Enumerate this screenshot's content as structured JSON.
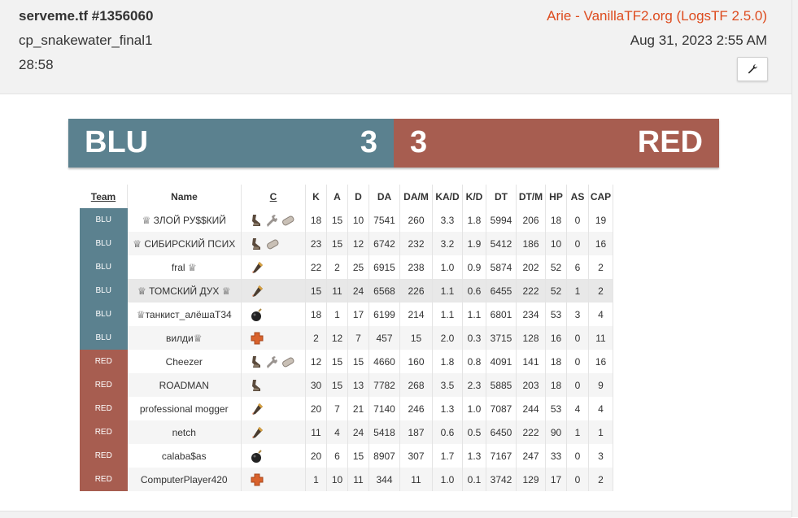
{
  "header": {
    "title": "serveme.tf #1356060",
    "map": "cp_snakewater_final1",
    "duration": "28:58",
    "uploader": "Arie - VanillaTF2.org (LogsTF 2.5.0)",
    "date": "Aug 31, 2023 2:55 AM",
    "tools_icon": "wrench-icon"
  },
  "score": {
    "blu": {
      "name": "BLU",
      "points": "3",
      "color": "#5b818f"
    },
    "red": {
      "name": "RED",
      "points": "3",
      "color": "#a75d50"
    }
  },
  "table": {
    "headers": {
      "team": "Team",
      "name": "Name",
      "class": "C",
      "k": "K",
      "a": "A",
      "d": "D",
      "da": "DA",
      "dam": "DA/M",
      "kad": "KA/D",
      "kd": "K/D",
      "dt": "DT",
      "dtm": "DT/M",
      "hp": "HP",
      "as": "AS",
      "cap": "CAP"
    },
    "rows": [
      {
        "team": "BLU",
        "name": "♕ ЗЛОЙ РУ$$КИЙ",
        "classes": [
          "scout-icon",
          "engineer-icon",
          "medic-pill-icon"
        ],
        "k": "18",
        "a": "15",
        "d": "10",
        "da": "7541",
        "dam": "260",
        "kad": "3.3",
        "kd": "1.8",
        "dt": "5994",
        "dtm": "206",
        "hp": "18",
        "as": "0",
        "cap": "19"
      },
      {
        "team": "BLU",
        "name": "♕ СИБИРСКИЙ ПСИХ",
        "classes": [
          "scout-icon",
          "medic-pill-icon"
        ],
        "k": "23",
        "a": "15",
        "d": "12",
        "da": "6742",
        "dam": "232",
        "kad": "3.2",
        "kd": "1.9",
        "dt": "5412",
        "dtm": "186",
        "hp": "10",
        "as": "0",
        "cap": "16"
      },
      {
        "team": "BLU",
        "name": "fral ♕",
        "classes": [
          "soldier-icon"
        ],
        "k": "22",
        "a": "2",
        "d": "25",
        "da": "6915",
        "dam": "238",
        "kad": "1.0",
        "kd": "0.9",
        "dt": "5874",
        "dtm": "202",
        "hp": "52",
        "as": "6",
        "cap": "2"
      },
      {
        "team": "BLU",
        "name": "♕ ТОМСКИЙ ДУХ ♕",
        "classes": [
          "soldier-icon"
        ],
        "k": "15",
        "a": "11",
        "d": "24",
        "da": "6568",
        "dam": "226",
        "kad": "1.1",
        "kd": "0.6",
        "dt": "6455",
        "dtm": "222",
        "hp": "52",
        "as": "1",
        "cap": "2"
      },
      {
        "team": "BLU",
        "name": "♕танкист_алёшаТ34",
        "classes": [
          "demoman-icon"
        ],
        "k": "18",
        "a": "1",
        "d": "17",
        "da": "6199",
        "dam": "214",
        "kad": "1.1",
        "kd": "1.1",
        "dt": "6801",
        "dtm": "234",
        "hp": "53",
        "as": "3",
        "cap": "4"
      },
      {
        "team": "BLU",
        "name": "вилди♕",
        "classes": [
          "medic-icon"
        ],
        "k": "2",
        "a": "12",
        "d": "7",
        "da": "457",
        "dam": "15",
        "kad": "2.0",
        "kd": "0.3",
        "dt": "3715",
        "dtm": "128",
        "hp": "16",
        "as": "0",
        "cap": "11"
      },
      {
        "team": "RED",
        "name": "Cheezer",
        "classes": [
          "scout-icon",
          "engineer-icon",
          "medic-pill-icon"
        ],
        "k": "12",
        "a": "15",
        "d": "15",
        "da": "4660",
        "dam": "160",
        "kad": "1.8",
        "kd": "0.8",
        "dt": "4091",
        "dtm": "141",
        "hp": "18",
        "as": "0",
        "cap": "16"
      },
      {
        "team": "RED",
        "name": "ROADMAN",
        "classes": [
          "scout-icon"
        ],
        "k": "30",
        "a": "15",
        "d": "13",
        "da": "7782",
        "dam": "268",
        "kad": "3.5",
        "kd": "2.3",
        "dt": "5885",
        "dtm": "203",
        "hp": "18",
        "as": "0",
        "cap": "9"
      },
      {
        "team": "RED",
        "name": "professional mogger",
        "classes": [
          "soldier-icon"
        ],
        "k": "20",
        "a": "7",
        "d": "21",
        "da": "7140",
        "dam": "246",
        "kad": "1.3",
        "kd": "1.0",
        "dt": "7087",
        "dtm": "244",
        "hp": "53",
        "as": "4",
        "cap": "4"
      },
      {
        "team": "RED",
        "name": "netch",
        "classes": [
          "soldier-icon"
        ],
        "k": "11",
        "a": "4",
        "d": "24",
        "da": "5418",
        "dam": "187",
        "kad": "0.6",
        "kd": "0.5",
        "dt": "6450",
        "dtm": "222",
        "hp": "90",
        "as": "1",
        "cap": "1"
      },
      {
        "team": "RED",
        "name": "calaba$as",
        "classes": [
          "demoman-icon"
        ],
        "k": "20",
        "a": "6",
        "d": "15",
        "da": "8907",
        "dam": "307",
        "kad": "1.7",
        "kd": "1.3",
        "dt": "7167",
        "dtm": "247",
        "hp": "33",
        "as": "0",
        "cap": "3"
      },
      {
        "team": "RED",
        "name": "ComputerPlayer420",
        "classes": [
          "medic-icon"
        ],
        "k": "1",
        "a": "10",
        "d": "11",
        "da": "344",
        "dam": "11",
        "kad": "1.0",
        "kd": "0.1",
        "dt": "3742",
        "dtm": "129",
        "hp": "17",
        "as": "0",
        "cap": "2"
      }
    ]
  }
}
